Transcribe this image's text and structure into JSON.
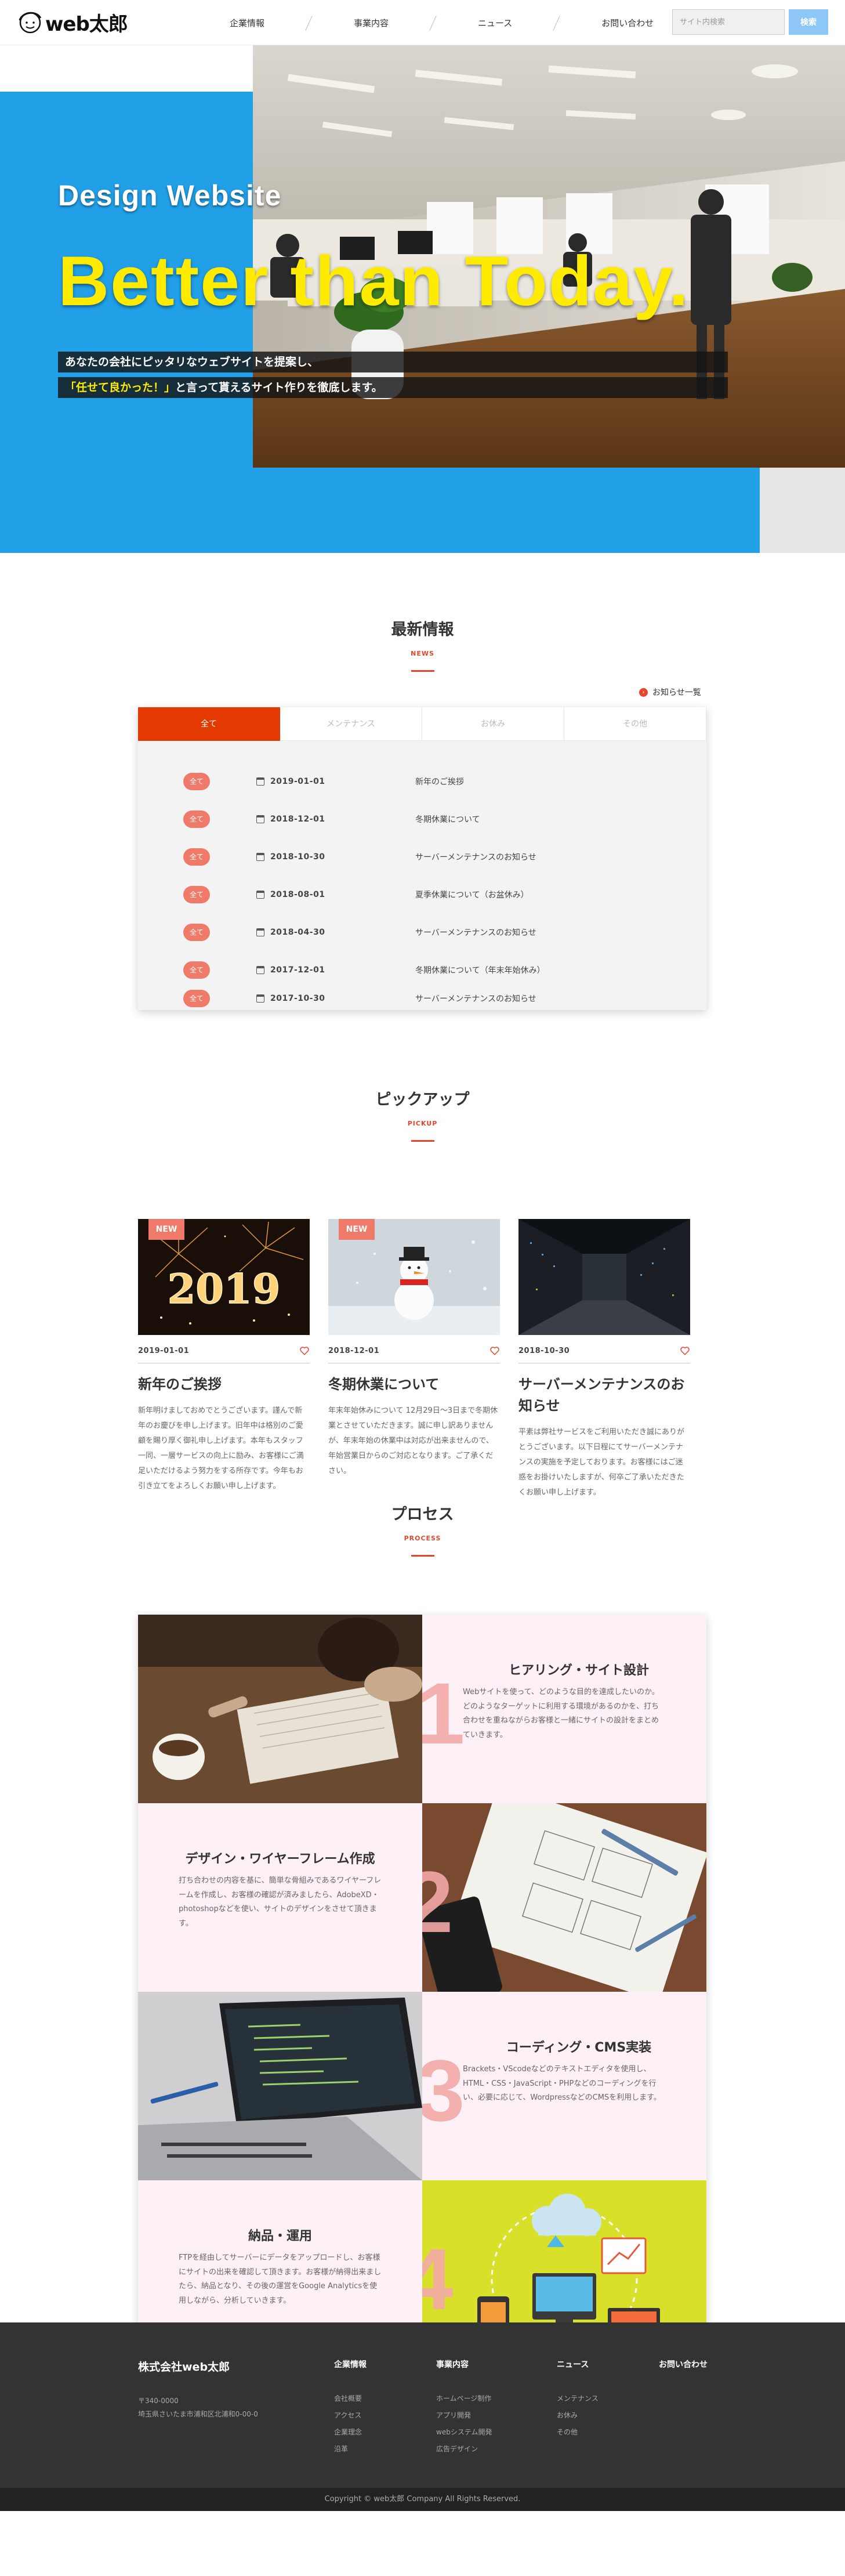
{
  "header": {
    "logo_text": "web太郎",
    "nav": [
      "企業情報",
      "事業内容",
      "ニュース",
      "お問い合わせ"
    ],
    "search_placeholder": "サイト内検索",
    "search_button": "検索"
  },
  "hero": {
    "title_small": "Design Website",
    "title_large": "Better than Today.",
    "line1": "あなたの会社にピッタリなウェブサイトを提案し、",
    "line2_highlight": "「任せて良かった！」",
    "line2_rest": "と言って貰えるサイト作りを徹底します。",
    "colors": {
      "blue": "#21a0e8",
      "yellow": "#ffeb00"
    }
  },
  "news": {
    "title": "最新情報",
    "subtitle": "NEWS",
    "more_link": "お知らせ一覧",
    "tabs": [
      "全て",
      "メンテナンス",
      "お休み",
      "その他"
    ],
    "items": [
      {
        "badge": "全て",
        "date": "2019-01-01",
        "title": "新年のご挨拶"
      },
      {
        "badge": "全て",
        "date": "2018-12-01",
        "title": "冬期休業について"
      },
      {
        "badge": "全て",
        "date": "2018-10-30",
        "title": "サーバーメンテナンスのお知らせ"
      },
      {
        "badge": "全て",
        "date": "2018-08-01",
        "title": "夏季休業について（お盆休み）"
      },
      {
        "badge": "全て",
        "date": "2018-04-30",
        "title": "サーバーメンテナンスのお知らせ"
      },
      {
        "badge": "全て",
        "date": "2017-12-01",
        "title": "冬期休業について（年末年始休み）"
      },
      {
        "badge": "全て",
        "date": "2017-10-30",
        "title": "サーバーメンテナンスのお知らせ"
      }
    ],
    "accent": "#e23a00"
  },
  "pickup": {
    "title": "ピックアップ",
    "subtitle": "PICKUP",
    "cards": [
      {
        "tag": "NEW",
        "date": "2019-01-01",
        "title": "新年のご挨拶",
        "text": "新年明けましておめでとうございます。謹んで新年のお慶びを申し上げます。旧年中は格別のご愛顧を賜り厚く御礼申し上げます。本年もスタッフ一同、一層サービスの向上に励み、お客様にご満足いただけるよう努力をする所存です。今年もお引き立てをよろしくお願い申し上げます。"
      },
      {
        "tag": "NEW",
        "date": "2018-12-01",
        "title": "冬期休業について",
        "text": "年末年始休みについて 12月29日〜3日まで冬期休業とさせていただきます。誠に申し訳ありませんが、年末年始の休業中は対応が出来ませんので、年始営業日からのご対応となります。ご了承ください。"
      },
      {
        "tag": "",
        "date": "2018-10-30",
        "title": "サーバーメンテナンスのお知らせ",
        "text": "平素は弊社サービスをご利用いただき誠にありがとうございます。以下日程にてサーバーメンテナンスの実施を予定しております。お客様にはご迷惑をお掛けいたしますが、何卒ご了承いただきたくお願い申し上げます。"
      }
    ]
  },
  "process": {
    "title": "プロセス",
    "subtitle": "PROCESS",
    "steps": [
      {
        "num": "1",
        "title": "ヒアリング・サイト設計",
        "text": "Webサイトを使って、どのような目的を達成したいのか。どのようなターゲットに利用する環境があるのかを、打ち合わせを重ねながらお客様と一緒にサイトの設計をまとめていきます。"
      },
      {
        "num": "2",
        "title": "デザイン・ワイヤーフレーム作成",
        "text": "打ち合わせの内容を基に、簡単な骨組みであるワイヤーフレームを作成し、お客様の確認が済みましたら、AdobeXD・photoshopなどを使い、サイトのデザインをさせて頂きます。"
      },
      {
        "num": "3",
        "title": "コーディング・CMS実装",
        "text": "Brackets・VScodeなどのテキストエディタを使用し、HTML・CSS・JavaScript・PHPなどのコーディングを行い、必要に応じて、WordpressなどのCMSを利用します。"
      },
      {
        "num": "4",
        "title": "納品・運用",
        "text": "FTPを経由してサーバーにデータをアップロードし、お客様にサイトの出来を確認して頂きます。お客様が納得出来ましたら、納品となり、その後の運営をGoogle Analyticsを使用しながら、分析していきます。"
      }
    ]
  },
  "footer": {
    "company": "株式会社web太郎",
    "postal": "〒340-0000",
    "address": "埼玉県さいたま市浦和区北浦和0-00-0",
    "columns": [
      {
        "title": "企業情報",
        "links": [
          "会社概要",
          "アクセス",
          "企業理念",
          "沿革"
        ]
      },
      {
        "title": "事業内容",
        "links": [
          "ホームページ制作",
          "アプリ開発",
          "webシステム開発",
          "広告デザイン"
        ]
      },
      {
        "title": "ニュース",
        "links": [
          "メンテナンス",
          "お休み",
          "その他"
        ]
      },
      {
        "title": "お問い合わせ",
        "links": []
      }
    ],
    "copyright": "Copyright © web太郎 Company All Rights Reserved."
  }
}
